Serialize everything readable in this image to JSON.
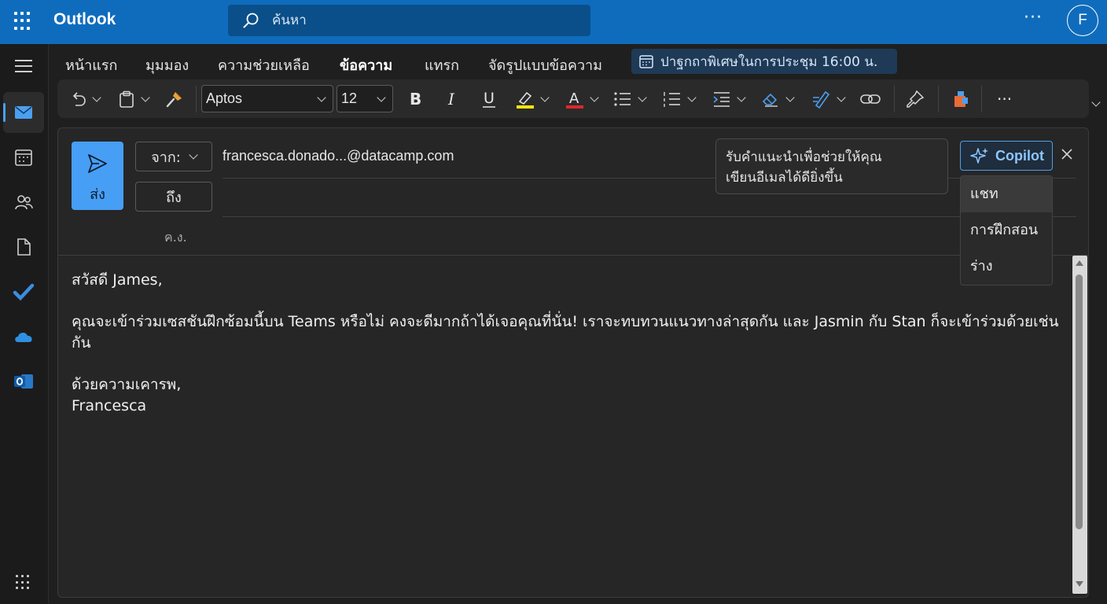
{
  "header": {
    "app_name": "Outlook",
    "search_placeholder": "ค้นหา",
    "more_label": "···",
    "avatar_initial": "F"
  },
  "tabs": [
    "หน้าแรก",
    "มุมมอง",
    "ความช่วยเหลือ",
    "ข้อความ",
    "แทรก",
    "จัดรูปแบบข้อความ"
  ],
  "active_tab": "ข้อความ",
  "notice": "ปาฐกถาพิเศษในการประชุม 16:00 น.",
  "ribbon": {
    "font_name": "Aptos",
    "font_size": "12",
    "more_label": "···",
    "colors": {
      "highlight": "#f5e50a",
      "font_color": "#e0262b"
    }
  },
  "compose": {
    "send_label": "ส่ง",
    "from_label": "จาก:",
    "from_address": "francesca.donado...@datacamp.com",
    "to_label": "ถึง",
    "cc_label": "ค.ง.",
    "copilot_tip": [
      "รับคำแนะนำเพื่อช่วยให้คุณ",
      "เขียนอีเมลได้ดียิ่งขึ้น"
    ],
    "copilot_label": "Copilot",
    "copilot_menu": [
      "แชท",
      "การฝึกสอน",
      "ร่าง"
    ]
  },
  "message": {
    "greeting": "สวัสดี James,",
    "paragraph": "คุณจะเข้าร่วมเซสชันฝึกซ้อมนี้บน Teams หรือไม่ คงจะดีมากถ้าได้เจอคุณที่นั่น! เราจะทบทวนแนวทางล่าสุดกัน และ Jasmin กับ Stan ก็จะเข้าร่วมด้วยเช่นกัน",
    "closing": "ด้วยความเคารพ,",
    "signature": "Francesca"
  },
  "accent_colors": {
    "topbar": "#0f6cbd",
    "send": "#479ef5",
    "copilot": "#4e9fe8"
  }
}
